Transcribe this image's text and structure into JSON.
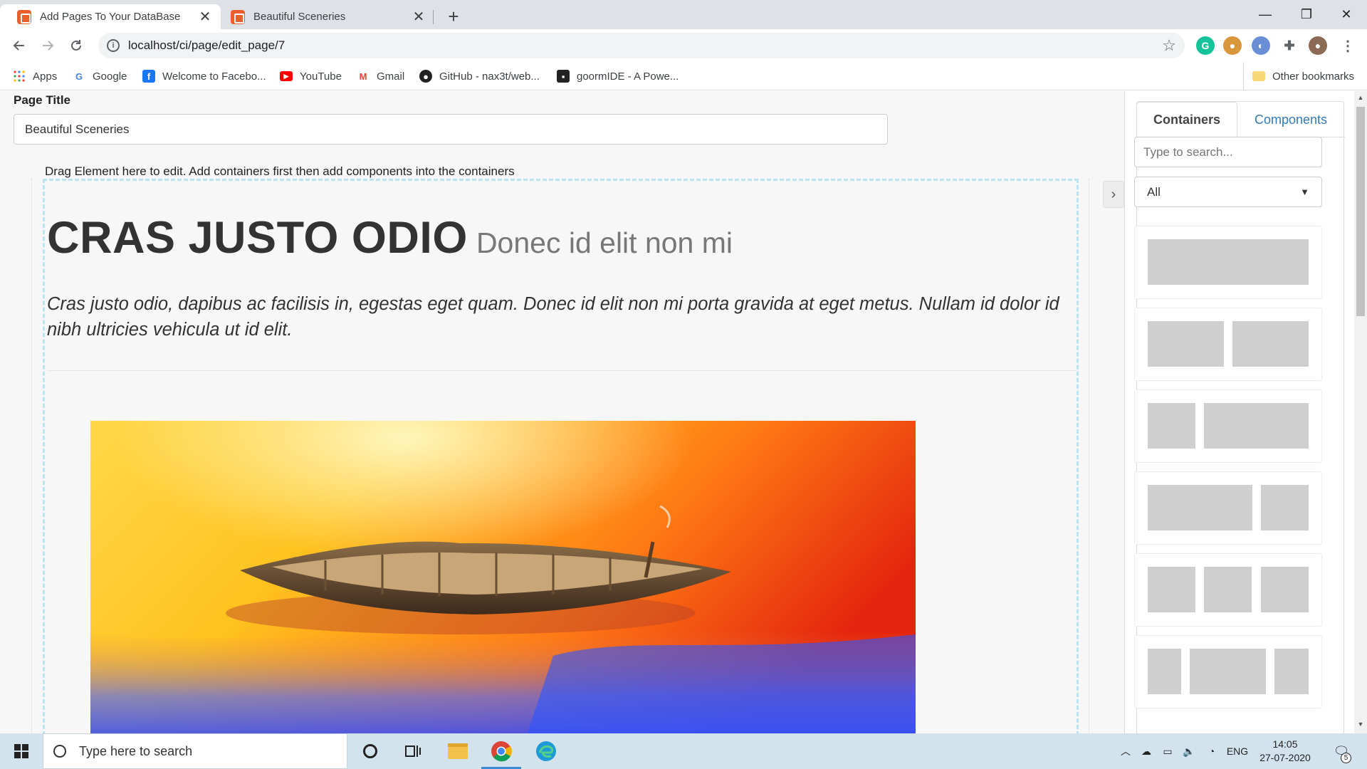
{
  "browser": {
    "tabs": [
      {
        "title": "Add Pages To Your DataBase",
        "close": "✕"
      },
      {
        "title": "Beautiful Sceneries",
        "close": "✕"
      }
    ],
    "new_tab": "+",
    "window_controls": {
      "minimize": "—",
      "maximize": "❐",
      "close": "✕"
    },
    "url": "localhost/ci/page/edit_page/7",
    "bookmarks": [
      "Apps",
      "Google",
      "Welcome to Facebo...",
      "YouTube",
      "Gmail",
      "GitHub - nax3t/web...",
      "goormIDE - A Powe..."
    ],
    "other_bookmarks": "Other bookmarks"
  },
  "editor": {
    "page_title_label": "Page Title",
    "page_title_value": "Beautiful Sceneries",
    "drag_hint": "Drag Element here to edit. Add containers first then add components into the containers",
    "heading_main": "CRAS JUSTO ODIO",
    "heading_sub": "Donec id elit non mi",
    "lead": "Cras justo odio, dapibus ac facilisis in, egestas eget quam. Donec id elit non mi porta gravida at eget metus. Nullam id dolor id nibh ultricies vehicula ut id elit."
  },
  "panel": {
    "tab_containers": "Containers",
    "tab_components": "Components",
    "search_placeholder": "Type to search...",
    "filter_value": "All"
  },
  "taskbar": {
    "search_placeholder": "Type here to search",
    "language": "ENG",
    "time": "14:05",
    "date": "27-07-2020",
    "notifications": "5"
  },
  "colors": {
    "accent_link": "#337ab7",
    "dropzone_border": "#bde3ef",
    "placeholder_block": "#cfcfcf"
  }
}
